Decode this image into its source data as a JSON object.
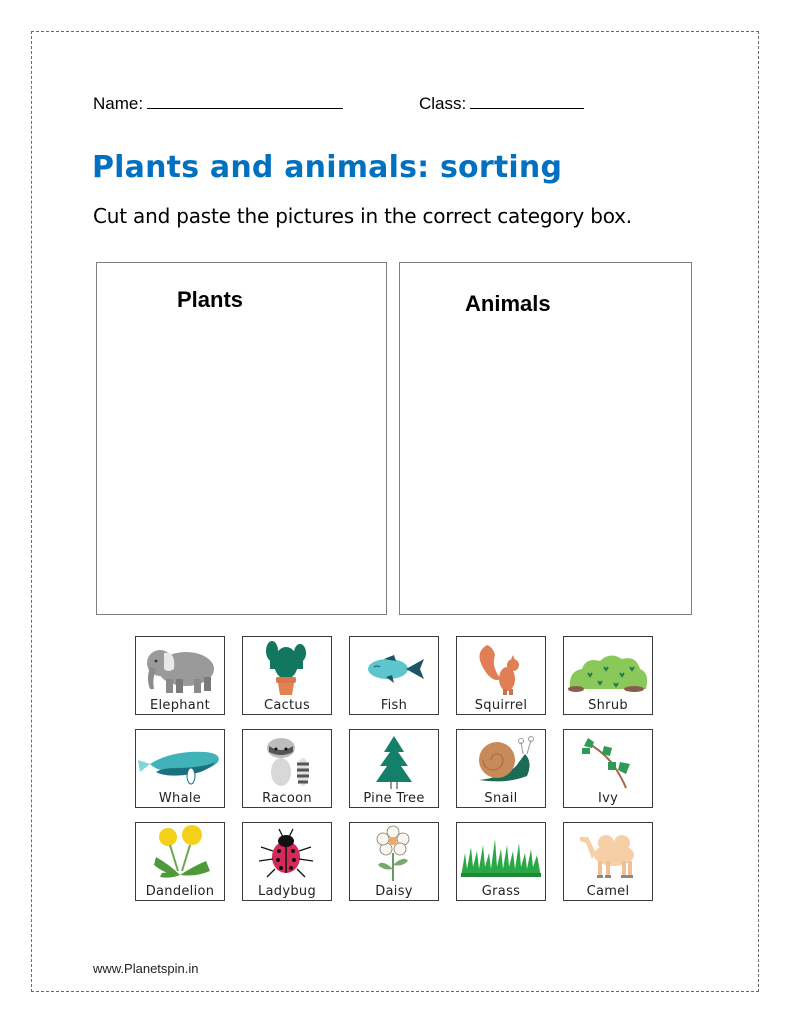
{
  "worksheet": {
    "name_label": "Name:",
    "class_label": "Class:",
    "title": "Plants and animals: sorting",
    "instructions": "Cut and paste the pictures in the correct category box.",
    "title_color": "#0070C0"
  },
  "categories": [
    {
      "label": "Plants"
    },
    {
      "label": "Animals"
    }
  ],
  "cards": [
    {
      "label": "Elephant",
      "icon": "elephant-icon"
    },
    {
      "label": "Cactus",
      "icon": "cactus-icon"
    },
    {
      "label": "Fish",
      "icon": "fish-icon"
    },
    {
      "label": "Squirrel",
      "icon": "squirrel-icon"
    },
    {
      "label": "Shrub",
      "icon": "shrub-icon"
    },
    {
      "label": "Whale",
      "icon": "whale-icon"
    },
    {
      "label": "Racoon",
      "icon": "racoon-icon"
    },
    {
      "label": "Pine Tree",
      "icon": "pine-tree-icon"
    },
    {
      "label": "Snail",
      "icon": "snail-icon"
    },
    {
      "label": "Ivy",
      "icon": "ivy-icon"
    },
    {
      "label": "Dandelion",
      "icon": "dandelion-icon"
    },
    {
      "label": "Ladybug",
      "icon": "ladybug-icon"
    },
    {
      "label": "Daisy",
      "icon": "daisy-icon"
    },
    {
      "label": "Grass",
      "icon": "grass-icon"
    },
    {
      "label": "Camel",
      "icon": "camel-icon"
    }
  ],
  "footer": {
    "website": "www.Planetspin.in"
  }
}
